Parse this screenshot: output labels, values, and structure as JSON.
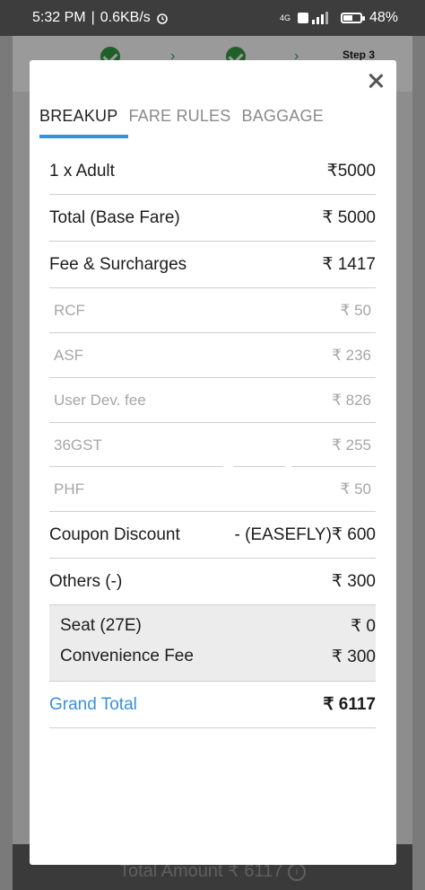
{
  "status_bar": {
    "time": "5:32 PM",
    "separator": "|",
    "speed": "0.6KB/s",
    "network": "4G",
    "battery": "48%",
    "battery_level": 0.48
  },
  "background": {
    "step_label": "Step 3",
    "footer_label": "Total Amount ₹ 6117"
  },
  "modal": {
    "tabs": [
      {
        "label": "BREAKUP",
        "active": true
      },
      {
        "label": "FARE RULES",
        "active": false
      },
      {
        "label": "BAGGAGE",
        "active": false
      }
    ],
    "rows": {
      "adult": {
        "label": "1 x Adult",
        "amount": "₹5000"
      },
      "base": {
        "label": "Total (Base Fare)",
        "amount": "₹ 5000"
      },
      "fees": {
        "label": "Fee & Surcharges",
        "amount": "₹ 1417"
      },
      "rcf": {
        "label": "RCF",
        "amount": "₹ 50"
      },
      "asf": {
        "label": "ASF",
        "amount": "₹ 236"
      },
      "udf": {
        "label": "User Dev. fee",
        "amount": "₹ 826"
      },
      "gst": {
        "label": "36GST",
        "amount": "₹ 255"
      },
      "phf": {
        "label": "PHF",
        "amount": "₹ 50"
      },
      "coupon": {
        "label": "Coupon Discount",
        "amount": "- (EASEFLY)₹ 600"
      },
      "others": {
        "label": "Others (-)",
        "amount": "₹ 300"
      },
      "seat": {
        "label": "Seat (27E)",
        "amount": "₹ 0"
      },
      "convenience": {
        "label": "Convenience Fee",
        "amount": "₹ 300"
      },
      "grand": {
        "label": "Grand Total",
        "amount": "₹ 6117"
      }
    }
  }
}
